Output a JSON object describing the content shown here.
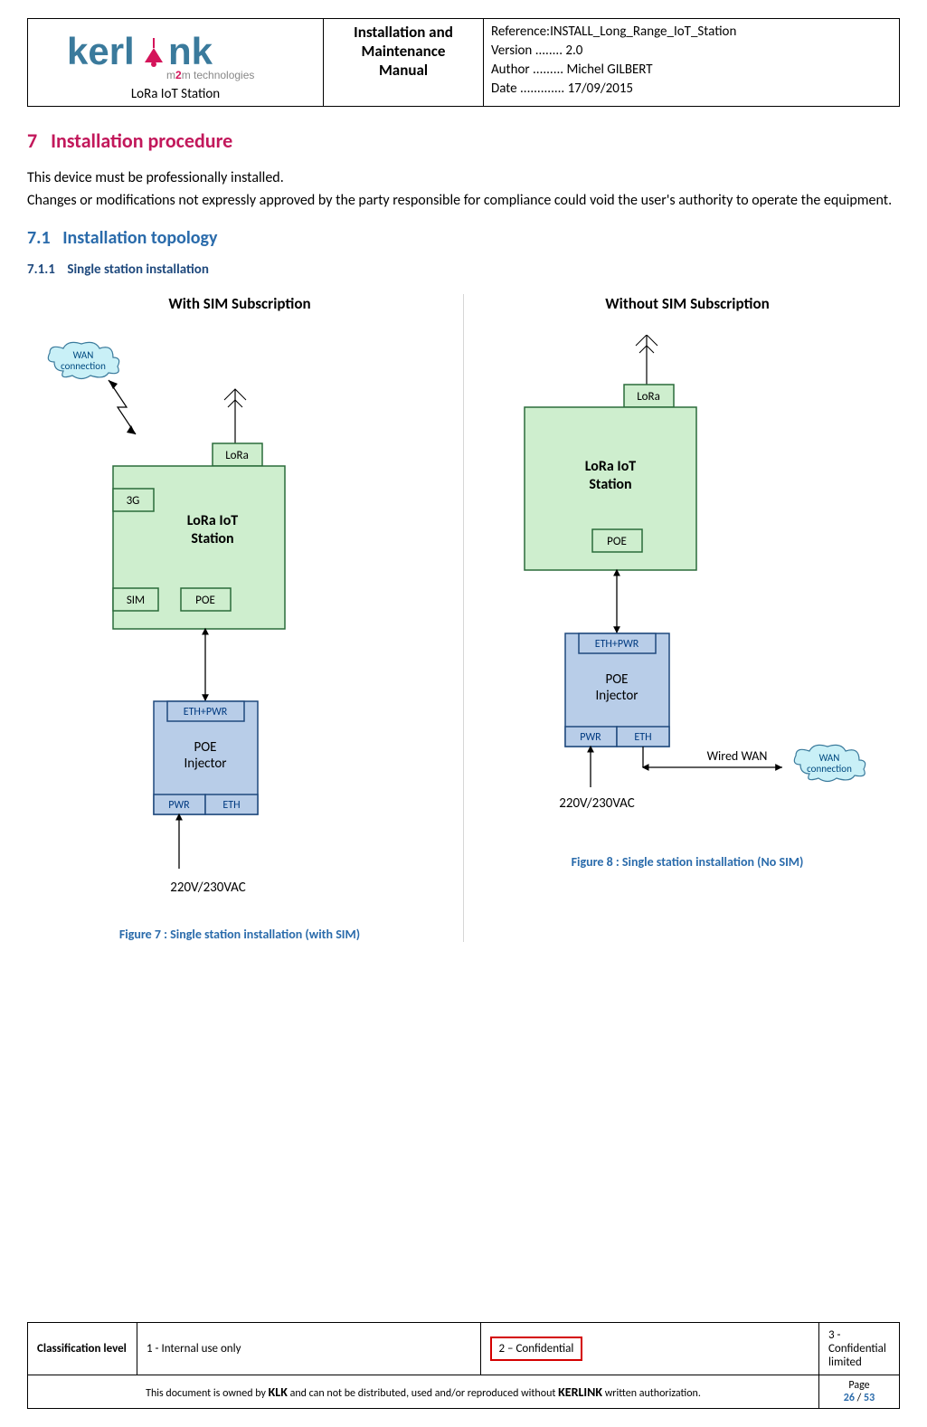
{
  "header": {
    "logo_text_1": "kerl",
    "logo_text_2": "nk",
    "logo_tag": "m2m technologies",
    "logo_sub": "LoRa IoT Station",
    "mid_line1": "Installation and",
    "mid_line2": "Maintenance",
    "mid_line3": "Manual",
    "ref_label": "Reference:",
    "ref_val": "INSTALL_Long_Range_IoT_Station",
    "ver_label": "Version ........",
    "ver_val": "2.0",
    "auth_label": "Author .........",
    "auth_val": "Michel GILBERT",
    "date_label": "Date .............",
    "date_val": "17/09/2015"
  },
  "sections": {
    "h1_num": "7",
    "h1_title": "Installation procedure",
    "p1": "This device must be professionally installed.",
    "p2": "Changes or modifications not expressly approved by the party responsible for compliance could void the user's authority to operate the equipment.",
    "h2_num": "7.1",
    "h2_title": "Installation topology",
    "h3_num": "7.1.1",
    "h3_title": "Single station installation"
  },
  "diagrams": {
    "left_title": "With SIM Subscription",
    "right_title": "Without SIM Subscription",
    "wan": "WAN connection",
    "lora": "LoRa",
    "station": "LoRa IoT Station",
    "g3": "3G",
    "sim": "SIM",
    "poe": "POE",
    "ethpwr": "ETH+PWR",
    "injector": "POE Injector",
    "pwr": "PWR",
    "eth": "ETH",
    "volts": "220V/230VAC",
    "wired": "Wired WAN",
    "fig7": "Figure 7 : Single station installation (with SIM)",
    "fig8": "Figure 8 : Single station installation (No SIM)"
  },
  "footer": {
    "class_label": "Classification level",
    "c1": "1 - Internal use only",
    "c2": "2 – Confidential",
    "c3": "3 - Confidential limited",
    "auth1": "This document is owned by ",
    "klk": "KLK",
    "auth2": " and can not be distributed, used and/or reproduced  without ",
    "kerlink": "KERLINK",
    "auth3": "  written authorization.",
    "page_label": "Page",
    "page_cur": "26",
    "page_sep": " / ",
    "page_total": "53"
  }
}
